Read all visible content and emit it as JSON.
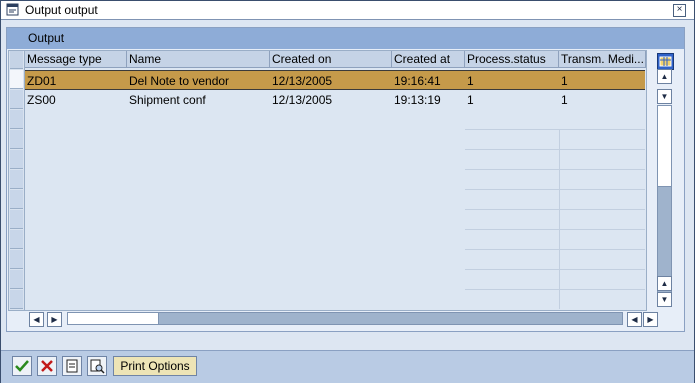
{
  "window": {
    "title": "Output output",
    "close_glyph": "×"
  },
  "panel": {
    "header": "Output"
  },
  "table": {
    "columns": [
      "Message type",
      "Name",
      "Created on",
      "Created at",
      "Process.status",
      "Transm. Medi..."
    ],
    "rows": [
      {
        "message_type": "ZD01",
        "name": "Del Note to vendor",
        "created_on": "12/13/2005",
        "created_at": "19:16:41",
        "process_status": "1",
        "transm_medium": "1",
        "selected": true
      },
      {
        "message_type": "ZS00",
        "name": "Shipment conf",
        "created_on": "12/13/2005",
        "created_at": "19:13:19",
        "process_status": "1",
        "transm_medium": "1",
        "selected": false
      }
    ]
  },
  "toolbar": {
    "print_options_label": "Print Options"
  },
  "icons": {
    "title": "window-icon",
    "confirm": "checkmark-icon",
    "cancel": "cancel-x-icon",
    "display": "document-icon",
    "print_preview": "print-preview-icon",
    "settings": "grid-settings-icon"
  },
  "colors": {
    "selected_row": "#c59a4a",
    "panel_header": "#8eacd7",
    "window_border": "#3a4e6e"
  }
}
